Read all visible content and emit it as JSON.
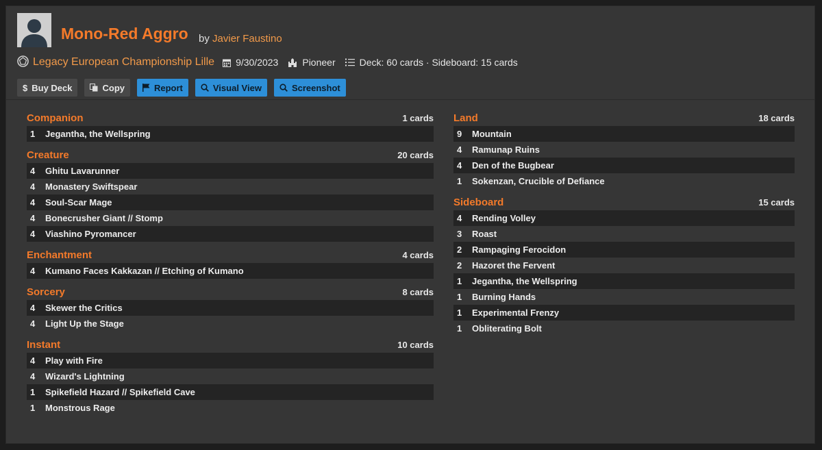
{
  "deck": {
    "title": "Mono-Red Aggro",
    "by_label": "by",
    "author": "Javier Faustino",
    "event": "Legacy European Championship Lille",
    "date": "9/30/2023",
    "format": "Pioneer",
    "counts": "Deck: 60 cards · Sideboard: 15 cards"
  },
  "buttons": {
    "buy": "Buy Deck",
    "copy": "Copy",
    "report": "Report",
    "visual": "Visual View",
    "screenshot": "Screenshot"
  },
  "left_sections": [
    {
      "title": "Companion",
      "count": "1 cards",
      "cards": [
        {
          "qty": "1",
          "name": "Jegantha, the Wellspring"
        }
      ]
    },
    {
      "title": "Creature",
      "count": "20 cards",
      "cards": [
        {
          "qty": "4",
          "name": "Ghitu Lavarunner"
        },
        {
          "qty": "4",
          "name": "Monastery Swiftspear"
        },
        {
          "qty": "4",
          "name": "Soul-Scar Mage"
        },
        {
          "qty": "4",
          "name": "Bonecrusher Giant // Stomp"
        },
        {
          "qty": "4",
          "name": "Viashino Pyromancer"
        }
      ]
    },
    {
      "title": "Enchantment",
      "count": "4 cards",
      "cards": [
        {
          "qty": "4",
          "name": "Kumano Faces Kakkazan // Etching of Kumano"
        }
      ]
    },
    {
      "title": "Sorcery",
      "count": "8 cards",
      "cards": [
        {
          "qty": "4",
          "name": "Skewer the Critics"
        },
        {
          "qty": "4",
          "name": "Light Up the Stage"
        }
      ]
    },
    {
      "title": "Instant",
      "count": "10 cards",
      "cards": [
        {
          "qty": "4",
          "name": "Play with Fire"
        },
        {
          "qty": "4",
          "name": "Wizard's Lightning"
        },
        {
          "qty": "1",
          "name": "Spikefield Hazard // Spikefield Cave"
        },
        {
          "qty": "1",
          "name": "Monstrous Rage"
        }
      ]
    }
  ],
  "right_sections": [
    {
      "title": "Land",
      "count": "18 cards",
      "cards": [
        {
          "qty": "9",
          "name": "Mountain"
        },
        {
          "qty": "4",
          "name": "Ramunap Ruins"
        },
        {
          "qty": "4",
          "name": "Den of the Bugbear"
        },
        {
          "qty": "1",
          "name": "Sokenzan, Crucible of Defiance"
        }
      ]
    },
    {
      "title": "Sideboard",
      "count": "15 cards",
      "cards": [
        {
          "qty": "4",
          "name": "Rending Volley"
        },
        {
          "qty": "3",
          "name": "Roast"
        },
        {
          "qty": "2",
          "name": "Rampaging Ferocidon"
        },
        {
          "qty": "2",
          "name": "Hazoret the Fervent"
        },
        {
          "qty": "1",
          "name": "Jegantha, the Wellspring"
        },
        {
          "qty": "1",
          "name": "Burning Hands"
        },
        {
          "qty": "1",
          "name": "Experimental Frenzy"
        },
        {
          "qty": "1",
          "name": "Obliterating Bolt"
        }
      ]
    }
  ],
  "colors": {
    "accent": "#f47a2a",
    "author": "#f29a4a",
    "button_blue": "#2d8fd8",
    "background": "#363636",
    "row_shade": "#242424"
  },
  "icons": [
    "user-avatar-icon",
    "dice-icon",
    "calendar-icon",
    "castle-icon",
    "list-icon",
    "dollar-icon",
    "copy-icon",
    "flag-icon",
    "search-icon"
  ]
}
